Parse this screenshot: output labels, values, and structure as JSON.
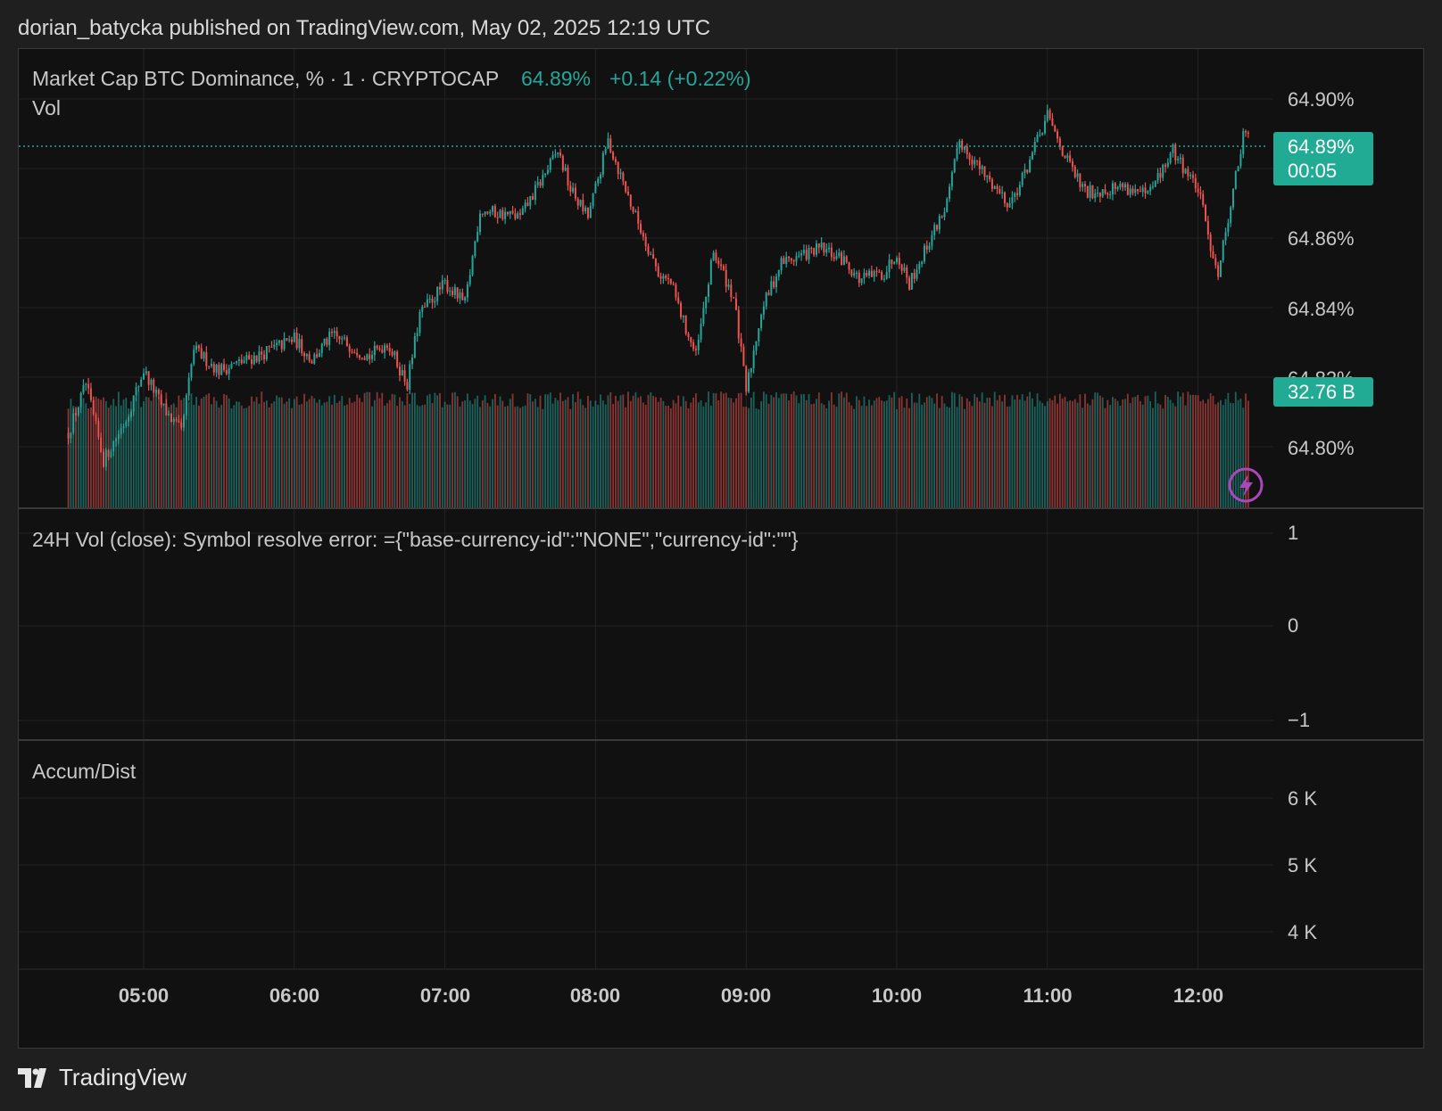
{
  "header": {
    "text": "dorian_batycka published on TradingView.com, May 02, 2025 12:19 UTC"
  },
  "legend": {
    "symbol": "Market Cap BTC Dominance, % · 1 · CRYPTOCAP",
    "price": "64.89%",
    "change": "+0.14 (+0.22%)",
    "vol_label": "Vol"
  },
  "price_axis": {
    "ticks": [
      "64.90%",
      "64.86%",
      "64.84%",
      "64.82%",
      "64.80%"
    ]
  },
  "badges": {
    "price": "64.89%",
    "countdown": "00:05",
    "volume": "32.76 B"
  },
  "pane2": {
    "label": "24H Vol (close): Symbol resolve error: ={\"base-currency-id\":\"NONE\",\"currency-id\":\"\"}",
    "ticks": [
      "1",
      "0",
      "−1"
    ]
  },
  "pane3": {
    "label": "Accum/Dist",
    "ticks": [
      "6 K",
      "5 K",
      "4 K"
    ]
  },
  "time_axis": {
    "ticks": [
      "05:00",
      "06:00",
      "07:00",
      "08:00",
      "09:00",
      "10:00",
      "11:00",
      "12:00"
    ]
  },
  "footer": {
    "brand": "TradingView"
  },
  "colors": {
    "up": "#26a69a",
    "down": "#ef5350",
    "accent_badge": "#22ab94",
    "lightning": "#ab47bc"
  },
  "chart_data": {
    "type": "candlestick",
    "title": "Market Cap BTC Dominance, % · 1 · CRYPTOCAP",
    "interval": "1",
    "last_price": 64.89,
    "change": 0.14,
    "change_pct": 0.22,
    "ylim": [
      64.788,
      64.91
    ],
    "time_range": [
      "04:30",
      "12:20"
    ],
    "path": [
      [
        "04:30",
        64.804
      ],
      [
        "04:37",
        64.818
      ],
      [
        "04:44",
        64.796
      ],
      [
        "04:53",
        64.808
      ],
      [
        "05:00",
        64.822
      ],
      [
        "05:07",
        64.812
      ],
      [
        "05:15",
        64.804
      ],
      [
        "05:20",
        64.828
      ],
      [
        "05:30",
        64.822
      ],
      [
        "05:45",
        64.826
      ],
      [
        "06:00",
        64.831
      ],
      [
        "06:07",
        64.825
      ],
      [
        "06:15",
        64.832
      ],
      [
        "06:30",
        64.826
      ],
      [
        "06:37",
        64.83
      ],
      [
        "06:45",
        64.818
      ],
      [
        "06:50",
        64.838
      ],
      [
        "07:00",
        64.847
      ],
      [
        "07:08",
        64.841
      ],
      [
        "07:14",
        64.868
      ],
      [
        "07:30",
        64.866
      ],
      [
        "07:45",
        64.885
      ],
      [
        "07:50",
        64.874
      ],
      [
        "07:57",
        64.866
      ],
      [
        "08:05",
        64.888
      ],
      [
        "08:15",
        64.868
      ],
      [
        "08:25",
        64.85
      ],
      [
        "08:30",
        64.847
      ],
      [
        "08:35",
        64.836
      ],
      [
        "08:40",
        64.826
      ],
      [
        "08:47",
        64.856
      ],
      [
        "08:55",
        64.843
      ],
      [
        "09:00",
        64.816
      ],
      [
        "09:06",
        64.839
      ],
      [
        "09:14",
        64.853
      ],
      [
        "09:30",
        64.857
      ],
      [
        "09:40",
        64.853
      ],
      [
        "09:45",
        64.848
      ],
      [
        "09:55",
        64.85
      ],
      [
        "10:00",
        64.856
      ],
      [
        "10:05",
        64.847
      ],
      [
        "10:20",
        64.87
      ],
      [
        "10:25",
        64.888
      ],
      [
        "10:35",
        64.878
      ],
      [
        "10:45",
        64.87
      ],
      [
        "10:50",
        64.877
      ],
      [
        "11:00",
        64.895
      ],
      [
        "11:08",
        64.882
      ],
      [
        "11:15",
        64.873
      ],
      [
        "11:30",
        64.875
      ],
      [
        "11:40",
        64.872
      ],
      [
        "11:50",
        64.885
      ],
      [
        "12:00",
        64.874
      ],
      [
        "12:05",
        64.858
      ],
      [
        "12:08",
        64.85
      ],
      [
        "12:13",
        64.87
      ],
      [
        "12:18",
        64.889
      ],
      [
        "12:20",
        64.89
      ]
    ],
    "volume_last": "32.76 B"
  }
}
